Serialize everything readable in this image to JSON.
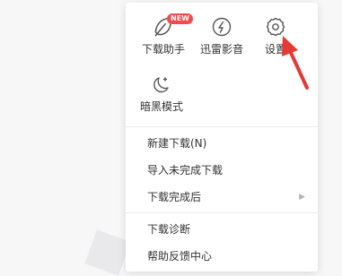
{
  "quick_actions": [
    {
      "label": "下载助手",
      "icon": "leaf-helper-icon",
      "badge": "NEW"
    },
    {
      "label": "迅雷影音",
      "icon": "play-circle-icon"
    },
    {
      "label": "设置",
      "icon": "gear-icon"
    },
    {
      "label": "暗黑模式",
      "icon": "moon-star-icon"
    }
  ],
  "menu_items": [
    {
      "label": "新建下载(N)"
    },
    {
      "label": "导入未完成下载"
    },
    {
      "label": "下载完成后",
      "has_submenu": true
    },
    {
      "label": "下载诊断"
    },
    {
      "label": "帮助反馈中心"
    }
  ],
  "colors": {
    "badge": "#f24a4a",
    "arrow": "#e53935",
    "icon": "#555555"
  }
}
